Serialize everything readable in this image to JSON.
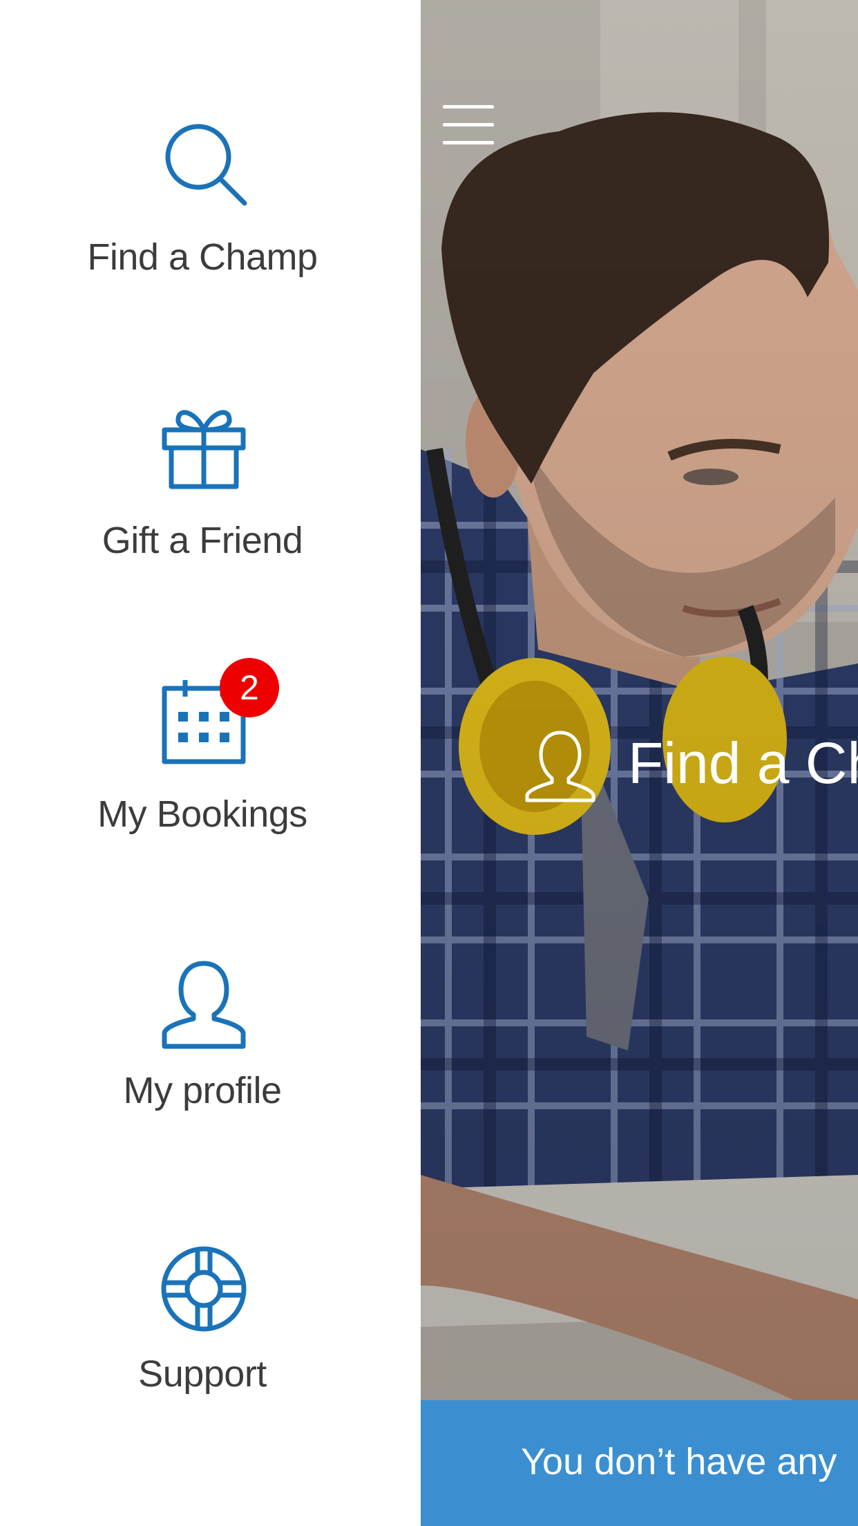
{
  "colors": {
    "accent": "#1a73b9",
    "badge": "#ef0000",
    "label_text": "#3c3c3c",
    "bottom_bar": "#3b8fd1",
    "drawer_background": "#ffffff"
  },
  "drawer": {
    "items": [
      {
        "label": "Find a Champ",
        "icon": "search-icon"
      },
      {
        "label": "Gift a Friend",
        "icon": "gift-icon"
      },
      {
        "label": "My Bookings",
        "icon": "calendar-icon",
        "badge": "2"
      },
      {
        "label": "My profile",
        "icon": "person-icon"
      },
      {
        "label": "Support",
        "icon": "lifebuoy-icon"
      }
    ]
  },
  "main": {
    "menu_icon": "hamburger-menu-icon",
    "hero": {
      "icon": "person-outline-icon",
      "label": "Find a Ch"
    },
    "bottom_bar": {
      "text": "You don’t have any"
    },
    "photo": "man-with-yellow-earmuffs-at-desk"
  }
}
